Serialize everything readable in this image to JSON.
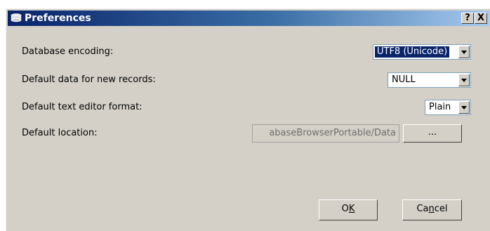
{
  "window": {
    "title": "Preferences",
    "help_label": "?",
    "close_label": "X"
  },
  "settings": {
    "encoding": {
      "label": "Database encoding:",
      "value": "UTF8 (Unicode)"
    },
    "default_data": {
      "label": "Default data for new records:",
      "value": "NULL"
    },
    "text_format": {
      "label": "Default text editor format:",
      "value": "Plain"
    },
    "location": {
      "label": "Default location:",
      "value": "abaseBrowserPortable/Data",
      "browse_label": "..."
    }
  },
  "buttons": {
    "ok": {
      "before": "O",
      "mnemonic": "K",
      "after": ""
    },
    "cancel": {
      "before": "Ca",
      "mnemonic": "n",
      "after": "cel"
    }
  },
  "icons": {
    "title": "database-icon",
    "dropdown": "chevron-down-icon"
  }
}
